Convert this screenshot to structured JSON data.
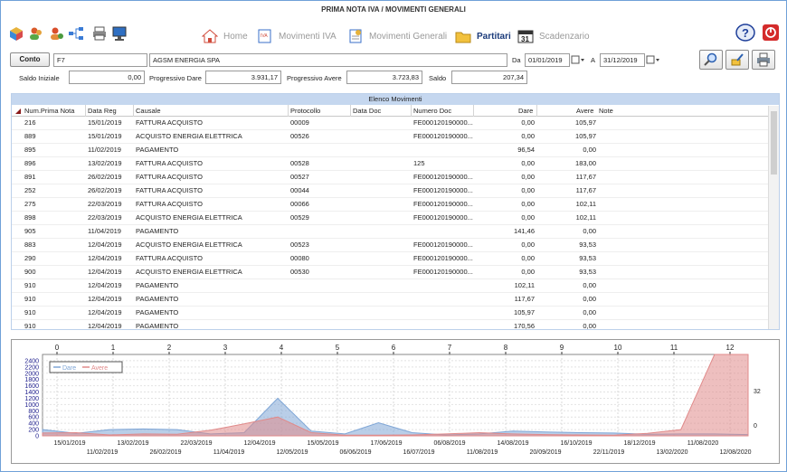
{
  "window": {
    "title": "PRIMA NOTA IVA / MOVIMENTI GENERALI"
  },
  "nav": [
    {
      "label": "Home",
      "icon": "home-icon",
      "active": false
    },
    {
      "label": "Movimenti IVA",
      "icon": "iva-icon",
      "active": false
    },
    {
      "label": "Movimenti Generali",
      "icon": "document-icon",
      "active": false
    },
    {
      "label": "Partitari",
      "icon": "folder-icon",
      "active": true
    },
    {
      "label": "Scadenzario",
      "icon": "calendar-icon",
      "active": false
    }
  ],
  "filters": {
    "conto_button": "Conto",
    "account_code": "F7",
    "account_name": "AGSM ENERGIA SPA",
    "da_label": "Da",
    "date_from": "01/01/2019",
    "a_label": "A",
    "date_to": "31/12/2019"
  },
  "totals": {
    "saldo_iniziale_label": "Saldo Iniziale",
    "saldo_iniziale": "0,00",
    "prog_dare_label": "Progressivo Dare",
    "prog_dare": "3.931,17",
    "prog_avere_label": "Progressivo Avere",
    "prog_avere": "3.723,83",
    "saldo_label": "Saldo",
    "saldo": "207,34"
  },
  "grid": {
    "title": "Elenco Movimenti",
    "columns": [
      "Num.Prima Nota",
      "Data Reg",
      "Causale",
      "Protocollo",
      "Data Doc",
      "Numero Doc",
      "Dare",
      "Avere",
      "Note"
    ],
    "rows": [
      [
        "216",
        "15/01/2019",
        "FATTURA ACQUISTO",
        "00009",
        "",
        "FE000120190000...",
        "0,00",
        "105,97"
      ],
      [
        "889",
        "15/01/2019",
        "ACQUISTO ENERGIA ELETTRICA",
        "00526",
        "",
        "FE000120190000...",
        "0,00",
        "105,97"
      ],
      [
        "895",
        "11/02/2019",
        "PAGAMENTO",
        "",
        "",
        "",
        "96,54",
        "0,00"
      ],
      [
        "896",
        "13/02/2019",
        "FATTURA ACQUISTO",
        "00528",
        "",
        "125",
        "0,00",
        "183,00"
      ],
      [
        "891",
        "26/02/2019",
        "FATTURA ACQUISTO",
        "00527",
        "",
        "FE000120190000...",
        "0,00",
        "117,67"
      ],
      [
        "252",
        "26/02/2019",
        "FATTURA ACQUISTO",
        "00044",
        "",
        "FE000120190000...",
        "0,00",
        "117,67"
      ],
      [
        "275",
        "22/03/2019",
        "FATTURA ACQUISTO",
        "00066",
        "",
        "FE000120190000...",
        "0,00",
        "102,11"
      ],
      [
        "898",
        "22/03/2019",
        "ACQUISTO ENERGIA ELETTRICA",
        "00529",
        "",
        "FE000120190000...",
        "0,00",
        "102,11"
      ],
      [
        "905",
        "11/04/2019",
        "PAGAMENTO",
        "",
        "",
        "",
        "141,46",
        "0,00"
      ],
      [
        "883",
        "12/04/2019",
        "ACQUISTO ENERGIA ELETTRICA",
        "00523",
        "",
        "FE000120190000...",
        "0,00",
        "93,53"
      ],
      [
        "290",
        "12/04/2019",
        "FATTURA ACQUISTO",
        "00080",
        "",
        "FE000120190000...",
        "0,00",
        "93,53"
      ],
      [
        "900",
        "12/04/2019",
        "ACQUISTO ENERGIA ELETTRICA",
        "00530",
        "",
        "FE000120190000...",
        "0,00",
        "93,53"
      ],
      [
        "910",
        "12/04/2019",
        "PAGAMENTO",
        "",
        "",
        "",
        "102,11",
        "0,00"
      ],
      [
        "910",
        "12/04/2019",
        "PAGAMENTO",
        "",
        "",
        "",
        "117,67",
        "0,00"
      ],
      [
        "910",
        "12/04/2019",
        "PAGAMENTO",
        "",
        "",
        "",
        "105,97",
        "0,00"
      ],
      [
        "910",
        "12/04/2019",
        "PAGAMENTO",
        "",
        "",
        "",
        "170,56",
        "0,00"
      ]
    ]
  },
  "chart_data": {
    "type": "area",
    "legend": [
      "Dare",
      "Avere"
    ],
    "colors": {
      "dare": "#7fa6d6",
      "avere": "#e08a8a"
    },
    "top_ticks": [
      "0",
      "1",
      "2",
      "3",
      "4",
      "5",
      "6",
      "7",
      "8",
      "9",
      "10",
      "11",
      "12"
    ],
    "y_left_ticks": [
      "0",
      "200",
      "400",
      "600",
      "800",
      "1000",
      "1200",
      "1400",
      "1600",
      "1800",
      "2000",
      "2200",
      "2400"
    ],
    "y_right_ticks": [
      "0",
      "32"
    ],
    "x_dates_row1": [
      "15/01/2019",
      "13/02/2019",
      "22/03/2019",
      "12/04/2019",
      "15/05/2019",
      "17/06/2019",
      "06/08/2019",
      "14/08/2019",
      "16/10/2019",
      "18/12/2019",
      "11/08/2020"
    ],
    "x_dates_row2": [
      "11/02/2019",
      "26/02/2019",
      "11/04/2019",
      "12/05/2019",
      "06/06/2019",
      "16/07/2019",
      "11/08/2019",
      "20/09/2019",
      "22/11/2019",
      "13/02/2020",
      "12/08/2020"
    ],
    "dare": [
      200,
      80,
      200,
      220,
      200,
      60,
      100,
      1200,
      150,
      60,
      420,
      100,
      30,
      60,
      150,
      120,
      100,
      90,
      50,
      60,
      60,
      40
    ],
    "avere": [
      90,
      100,
      30,
      60,
      50,
      180,
      380,
      600,
      100,
      20,
      20,
      30,
      60,
      100,
      60,
      40,
      30,
      20,
      80,
      200,
      2600,
      2600
    ],
    "ylim": [
      0,
      2600
    ]
  }
}
